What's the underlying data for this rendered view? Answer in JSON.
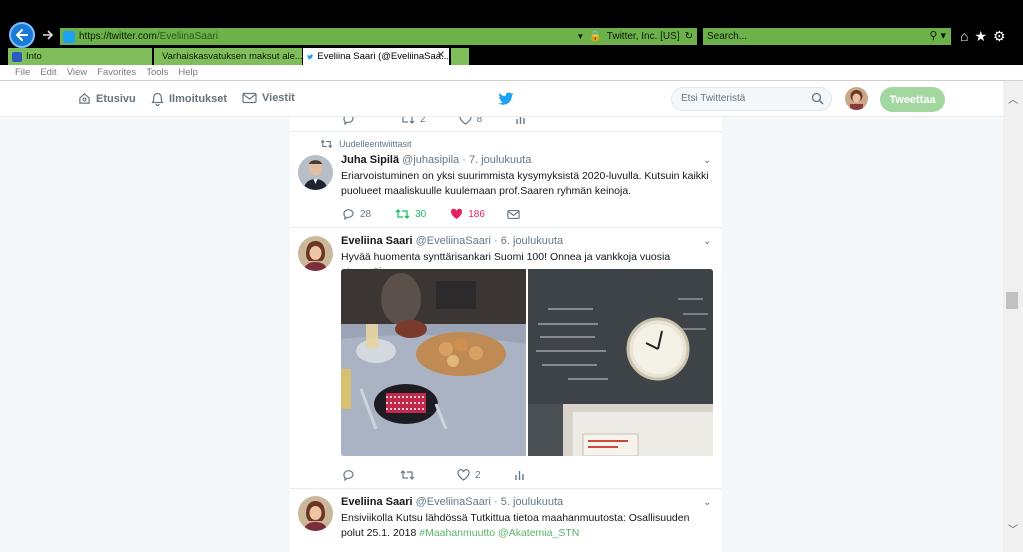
{
  "browser": {
    "url_scheme": "https://",
    "url_host": "twitter.com",
    "url_path": "/EveliinaSaari",
    "site_identity": "Twitter, Inc. [US]",
    "search_placeholder": "Search...",
    "tabs": [
      {
        "label": "Into"
      },
      {
        "label": "Varhaiskasvatuksen maksut ale..."
      },
      {
        "label": "Eveliina Saari (@EveliinaSaa...",
        "active": true
      }
    ],
    "menu": [
      "File",
      "Edit",
      "View",
      "Favorites",
      "Tools",
      "Help"
    ]
  },
  "twitter_nav": {
    "home": "Etusivu",
    "notifications": "Ilmoitukset",
    "messages": "Viestit",
    "search_placeholder": "Etsi Twitteristä",
    "tweet_button": "Tweettaa"
  },
  "colors": {
    "twitter_blue": "#1da1f2",
    "like_red": "#e0245e",
    "retweet_green": "#17bf63",
    "browser_green": "#6db14a"
  },
  "stream": {
    "top_actions": {
      "retweets": "2",
      "likes": "8"
    },
    "tweets": [
      {
        "retweet_label": "Uudelleentwiittasit",
        "name": "Juha Sipilä",
        "handle": "@juhasipila",
        "date": "· 7. joulukuuta",
        "text": "Eriarvoistuminen on yksi suurimmista kysymyksistä 2020-luvulla. Kutsuin kaikki puolueet maaliskuulle kuulemaan prof.Saaren ryhmän keinoja.",
        "replies": "28",
        "retweets": "30",
        "likes": "186"
      },
      {
        "name": "Eveliina Saari",
        "handle": "@EveliinaSaari",
        "date": "· 6. joulukuuta",
        "text": "Hyvää huomenta synttärisankari Suomi 100! Onnea ja vankkoja vuosia eteenpäin.",
        "likes": "2"
      },
      {
        "name": "Eveliina Saari",
        "handle": "@EveliinaSaari",
        "date": "· 5. joulukuuta",
        "text_part1": "Ensiviikolla Kutsu lähdössä Tutkittua tietoa maahanmuutosta: Osallisuuden polut 25.1. 2018 ",
        "hashtag": "#Maahanmuutto",
        "mention": "@Akatemia_STN"
      }
    ]
  }
}
